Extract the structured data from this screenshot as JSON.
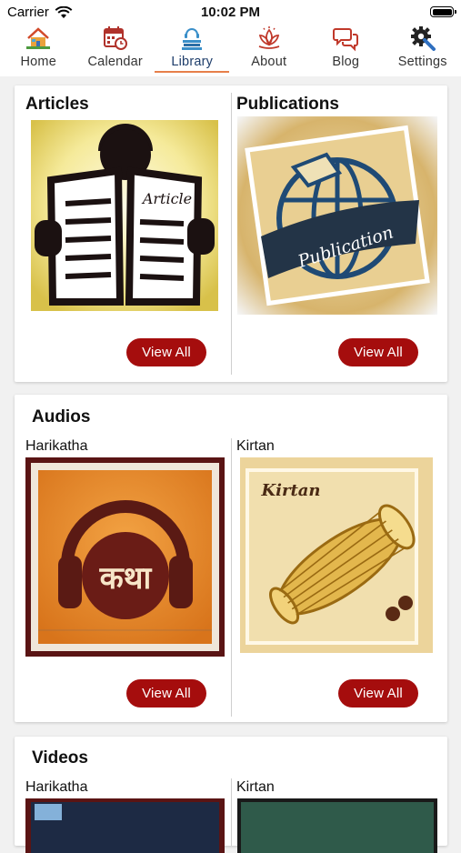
{
  "status_bar": {
    "carrier": "Carrier",
    "time": "10:02 PM"
  },
  "tabs": [
    {
      "label": "Home",
      "icon": "home-icon"
    },
    {
      "label": "Calendar",
      "icon": "calendar-icon"
    },
    {
      "label": "Library",
      "icon": "library-icon",
      "active": true
    },
    {
      "label": "About",
      "icon": "lotus-icon"
    },
    {
      "label": "Blog",
      "icon": "chat-bubbles-icon"
    },
    {
      "label": "Settings",
      "icon": "gear-icon"
    }
  ],
  "library": {
    "articles": {
      "title": "Articles",
      "image_text": "Article",
      "button": "View All"
    },
    "publications": {
      "title": "Publications",
      "image_text": "Publication",
      "button": "View All"
    },
    "audios": {
      "title": "Audios",
      "left": {
        "label": "Harikatha",
        "image_text": "कथा",
        "button": "View All"
      },
      "right": {
        "label": "Kirtan",
        "image_text": "Kirtan",
        "button": "View All"
      }
    },
    "videos": {
      "title": "Videos",
      "left": {
        "label": "Harikatha"
      },
      "right": {
        "label": "Kirtan"
      }
    }
  },
  "colors": {
    "accent": "#a50d0d",
    "active_tab_underline": "#e77f4a",
    "active_tab_text": "#1f3e6b"
  }
}
